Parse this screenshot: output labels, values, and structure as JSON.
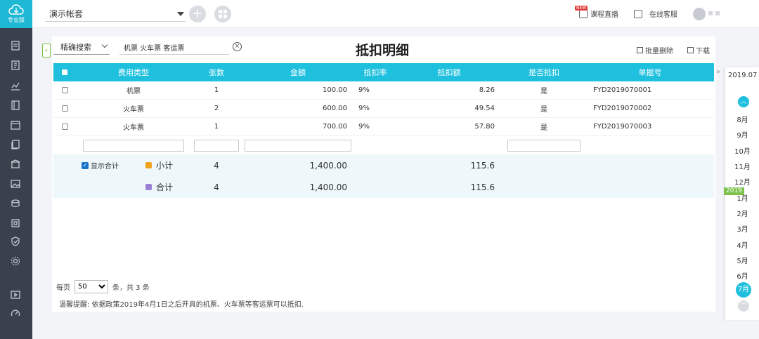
{
  "app": {
    "logo_text": "专业版",
    "account_name": "演示帐套",
    "new_badge": "NEW",
    "course_live": "课程直播",
    "online_service": "在线客服"
  },
  "toolbar": {
    "search_mode": "精确搜索",
    "search_value": "机票 火车票 客运票",
    "page_title": "抵扣明细",
    "batch_delete": "批量删除",
    "download": "下载"
  },
  "table": {
    "headers": [
      "费用类型",
      "张数",
      "金额",
      "抵扣率",
      "抵扣额",
      "是否抵扣",
      "单据号"
    ],
    "rows": [
      {
        "type": "机票",
        "count": "1",
        "amount": "100.00",
        "rate": "9%",
        "deduction": "8.26",
        "deducted": "是",
        "doc_no": "FYD2019070001"
      },
      {
        "type": "火车票",
        "count": "2",
        "amount": "600.00",
        "rate": "9%",
        "deduction": "49.54",
        "deducted": "是",
        "doc_no": "FYD2019070002"
      },
      {
        "type": "火车票",
        "count": "1",
        "amount": "700.00",
        "rate": "9%",
        "deduction": "57.80",
        "deducted": "是",
        "doc_no": "FYD2019070003"
      }
    ],
    "show_total_label": "显示合计",
    "subtotal": {
      "label": "小计",
      "count": "4",
      "amount": "1,400.00",
      "deduction": "115.6"
    },
    "total": {
      "label": "合计",
      "count": "4",
      "amount": "1,400.00",
      "deduction": "115.6"
    }
  },
  "pager": {
    "per_page_label": "每页",
    "per_page_value": "50",
    "summary": "条，共 3 条"
  },
  "tip": "温馨提醒: 依据政策2019年4月1日之后开具的机票、火车票等客运票可以抵扣.",
  "months_panel": {
    "current": "2019.07",
    "year_badge": "2019",
    "months": [
      "8月",
      "9月",
      "10月",
      "11月",
      "12月",
      "1月",
      "2月",
      "3月",
      "4月",
      "5月",
      "6月",
      "7月"
    ],
    "selected": "7月"
  },
  "colors": {
    "accent": "#1fc0de",
    "sidebar": "#3a414d",
    "green": "#7cc24a",
    "checkbox_blue": "#1a73c8",
    "subtotal_icon": "#f0a31c",
    "total_icon": "#9b7fd6"
  }
}
